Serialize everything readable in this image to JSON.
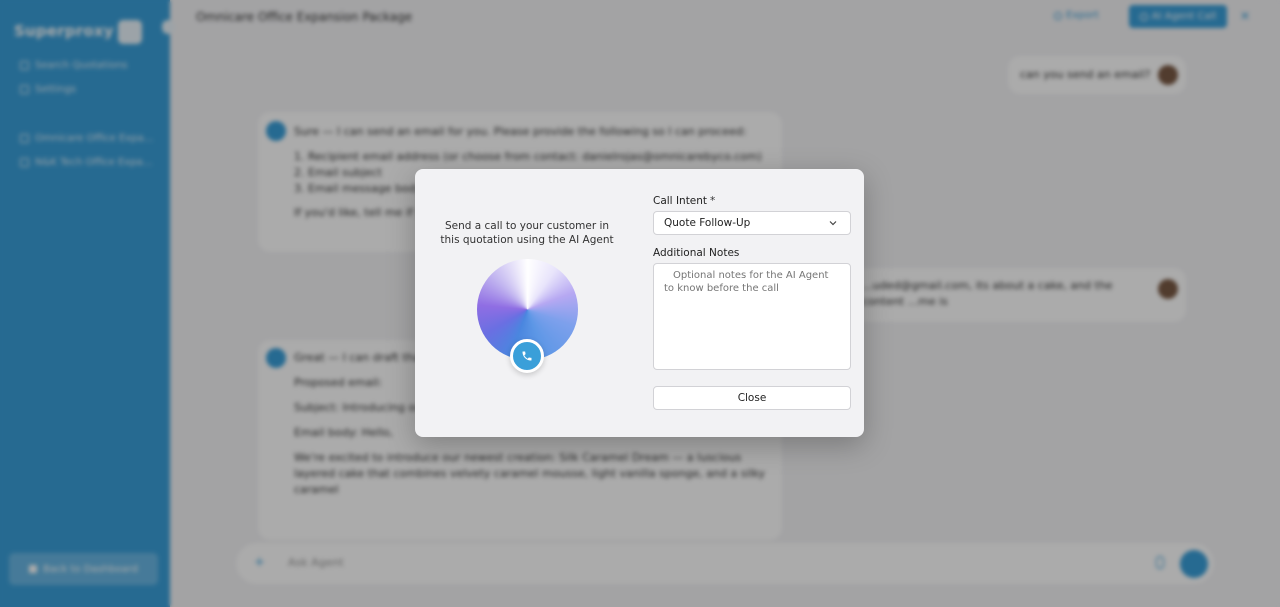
{
  "sidebar": {
    "brand": "Superproxy",
    "nav": [
      {
        "label": "Search Quotations",
        "icon": "search-icon"
      },
      {
        "label": "Settings",
        "icon": "gear-icon"
      }
    ],
    "recent": [
      {
        "label": "Omnicare Office Expa...",
        "icon": "document-icon"
      },
      {
        "label": "N&K Tech Office Expa...",
        "icon": "document-icon"
      }
    ],
    "back_label": "Back to Dashboard"
  },
  "topbar": {
    "title": "Omnicare Office Expansion Package",
    "export_label": "Export",
    "agent_call_label": "AI Agent Call"
  },
  "chat": {
    "user_msg_1": "can you send an email?",
    "bot_msg_1": {
      "intro": "Sure — I can send an email for you. Please provide the following so I can proceed:",
      "items": [
        "Recipient email address (or choose from contact: danielrojas@omnicarebyco.com)",
        "Email subject",
        "Email message body"
      ],
      "outro": "If you'd like, tell me if you want... phone)."
    },
    "user_msg_2": "...uded@gmail.com, its about a cake, and the content ...me is",
    "bot_msg_2": {
      "p1": "Great — I can draft that ... advertising a cake with ... desperately what named ... it?",
      "p2": "Proposed email:",
      "p3": "Subject: Introducing our new cake — Silk Caramel Dream (Preorder Now!)",
      "p4": "Email body: Hello,",
      "p5": "We're excited to introduce our newest creation: Silk Caramel Dream — a luscious layered cake that combines velvety caramel mousse, light vanilla sponge, and a silky caramel"
    }
  },
  "composer": {
    "placeholder": "Ask Agent"
  },
  "modal": {
    "description": "Send a call to your customer in this quotation using the AI Agent",
    "call_intent_label": "Call Intent",
    "required_mark": "*",
    "call_intent_value": "Quote Follow-Up",
    "notes_label": "Additional Notes",
    "notes_placeholder": "Optional notes for the AI Agent to know before the call",
    "close_label": "Close"
  },
  "colors": {
    "accent": "#3a9fd9",
    "modal_bg": "#f2f2f4"
  }
}
